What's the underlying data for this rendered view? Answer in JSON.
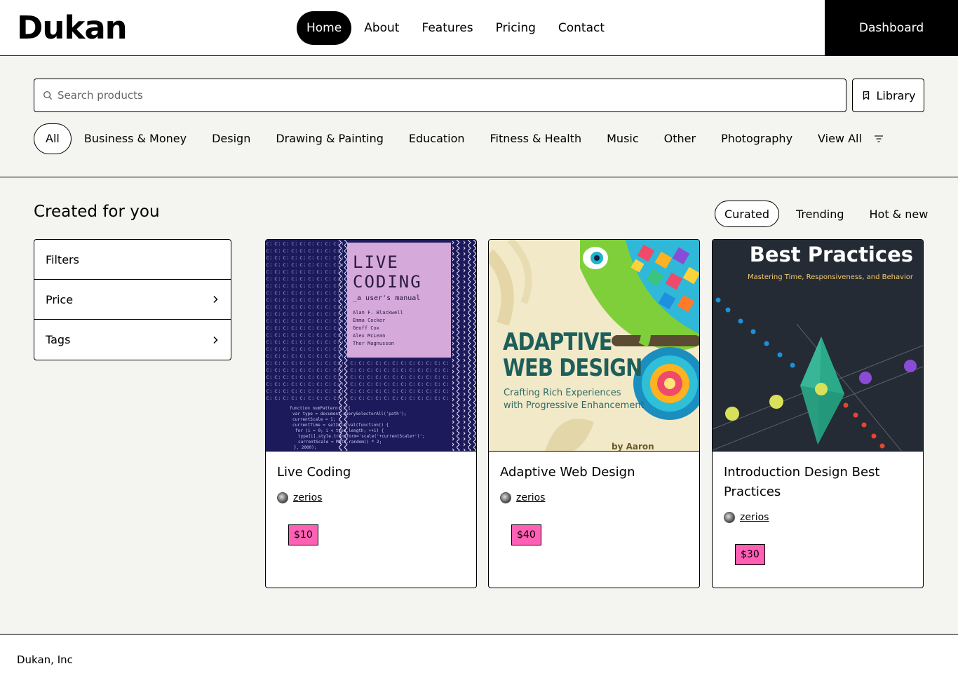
{
  "brand": "Dukan",
  "nav": {
    "items": [
      "Home",
      "About",
      "Features",
      "Pricing",
      "Contact"
    ],
    "dashboard": "Dashboard"
  },
  "search": {
    "placeholder": "Search products",
    "library_label": "Library"
  },
  "categories": [
    "All",
    "Business & Money",
    "Design",
    "Drawing & Painting",
    "Education",
    "Fitness & Health",
    "Music",
    "Other",
    "Photography",
    "View All"
  ],
  "main": {
    "title": "Created for you",
    "sort_tabs": [
      "Curated",
      "Trending",
      "Hot & new"
    ]
  },
  "filters": [
    "Filters",
    "Price",
    "Tags"
  ],
  "products": [
    {
      "title": "Live Coding",
      "author": "zerios",
      "price": "$10",
      "cover": {
        "title": "LIVE CODING",
        "subtitle": "_a user's manual",
        "authors": "Alan F. Blackwell\nEmma Cocker\nGeoff Cox\nAlex McLean\nThor Magnusson"
      }
    },
    {
      "title": "Adaptive Web Design",
      "author": "zerios",
      "price": "$40",
      "cover": {
        "title_line1": "ADAPTIVE",
        "title_line2": "WEB DESIGN",
        "subtitle_line1": "Crafting Rich Experiences",
        "subtitle_line2": "with Progressive Enhancement",
        "byline": "by Aaron Gustafson"
      }
    },
    {
      "title": "Introduction Design Best Practices",
      "author": "zerios",
      "price": "$30",
      "cover": {
        "title": "Best Practices",
        "subtitle": "Mastering Time, Responsiveness, and Behavior"
      }
    }
  ],
  "footer": {
    "text": "Dukan, Inc"
  },
  "colors": {
    "accent_pink": "#ff5fb4",
    "page_bg": "#f4f4f0"
  }
}
